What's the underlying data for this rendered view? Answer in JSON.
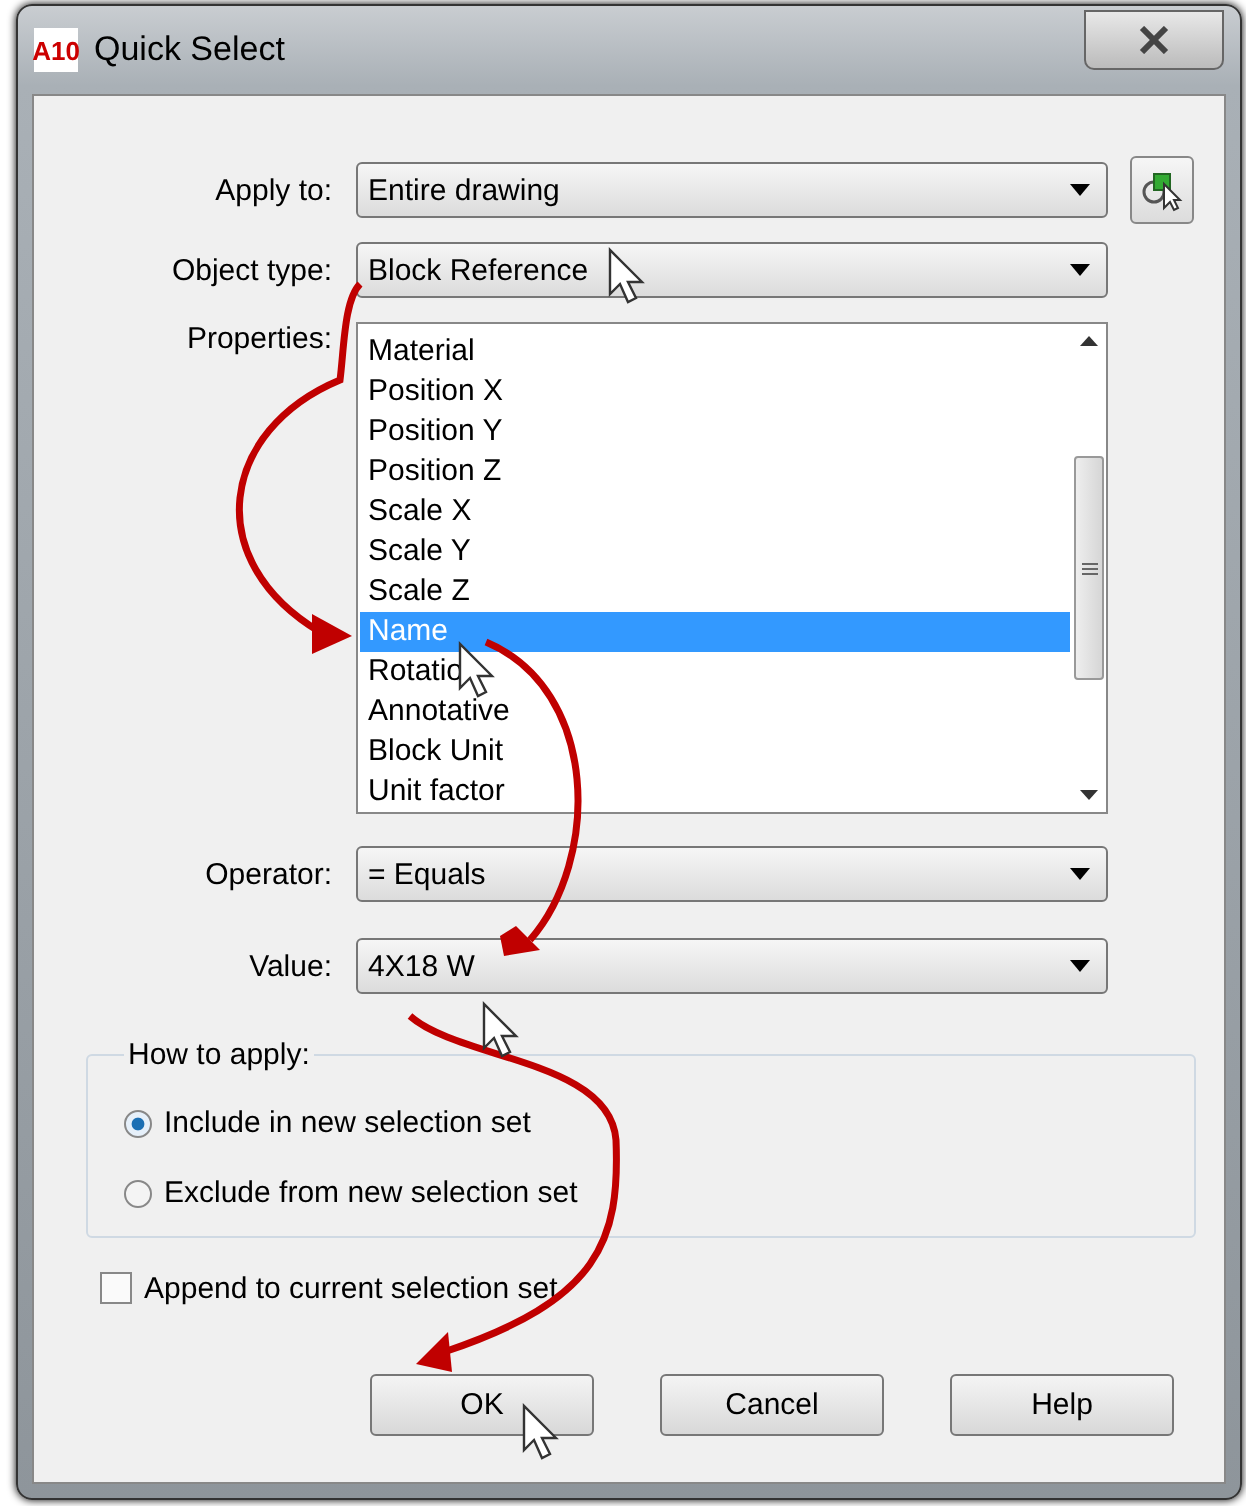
{
  "window": {
    "title": "Quick Select",
    "icon_text": "A10"
  },
  "fields": [
    {
      "label": "Apply to:",
      "value": "Entire drawing",
      "kind": "dropdown"
    },
    {
      "label": "Object type:",
      "value": "Block Reference",
      "kind": "dropdown"
    }
  ],
  "properties": {
    "label": "Properties:",
    "items": [
      {
        "text": "Material",
        "selected": false
      },
      {
        "text": "Position X",
        "selected": false
      },
      {
        "text": "Position Y",
        "selected": false
      },
      {
        "text": "Position Z",
        "selected": false
      },
      {
        "text": "Scale X",
        "selected": false
      },
      {
        "text": "Scale Y",
        "selected": false
      },
      {
        "text": "Scale Z",
        "selected": false
      },
      {
        "text": "Name",
        "selected": true
      },
      {
        "text": "Rotatio",
        "selected": false
      },
      {
        "text": "Annotative",
        "selected": false
      },
      {
        "text": "Block Unit",
        "selected": false
      },
      {
        "text": "Unit factor",
        "selected": false
      }
    ]
  },
  "conditions": [
    {
      "label": "Operator:",
      "value": "= Equals"
    },
    {
      "label": "Value:",
      "value": "4X18 W"
    }
  ],
  "how_to_apply": {
    "legend": "How to apply:",
    "options": [
      {
        "label": "Include in new selection set",
        "selected": true
      },
      {
        "label": "Exclude from new selection set",
        "selected": false
      }
    ]
  },
  "append": {
    "label": "Append to current selection set",
    "checked": false
  },
  "buttons": [
    "OK",
    "Cancel",
    "Help"
  ]
}
